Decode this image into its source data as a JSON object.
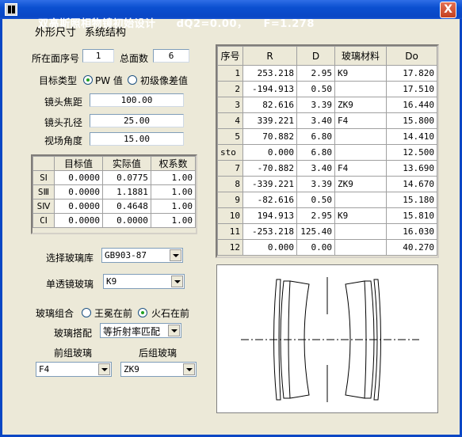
{
  "window": {
    "title": "双高斯照相物镜初始设计",
    "status_dq2": "dQ2=0.00，",
    "status_f": "F=1.278",
    "close_label": "X"
  },
  "menu": {
    "items": [
      "外形尺寸",
      "系统结构"
    ]
  },
  "surface": {
    "label": "所在面序号",
    "value": "1",
    "total_label": "总面数",
    "total_value": "6"
  },
  "target_type": {
    "label": "目标类型",
    "options": [
      "PW 值",
      "初级像差值"
    ],
    "selected": 0
  },
  "params": [
    {
      "label": "镜头焦距",
      "value": "100.00"
    },
    {
      "label": "镜头孔径",
      "value": "25.00"
    },
    {
      "label": "视场角度",
      "value": "15.00"
    }
  ],
  "aberration_table": {
    "headers": [
      "目标值",
      "实际值",
      "权系数"
    ],
    "rows": [
      {
        "name": "SⅠ",
        "target": "0.0000",
        "actual": "0.0775",
        "weight": "1.00"
      },
      {
        "name": "SⅢ",
        "target": "0.0000",
        "actual": "1.1881",
        "weight": "1.00"
      },
      {
        "name": "SⅣ",
        "target": "0.0000",
        "actual": "0.4648",
        "weight": "1.00"
      },
      {
        "name": "CⅠ",
        "target": "0.0000",
        "actual": "0.0000",
        "weight": "1.00"
      }
    ]
  },
  "glass_library": {
    "label": "选择玻璃库",
    "value": "GB903-87"
  },
  "single_lens_glass": {
    "label": "单透镜玻璃",
    "value": "K9"
  },
  "glass_combo": {
    "label": "玻璃组合",
    "options": [
      "王冕在前",
      "火石在前"
    ],
    "selected": 1
  },
  "glass_match": {
    "label": "玻璃搭配",
    "value": "等折射率匹配"
  },
  "front_group": {
    "label": "前组玻璃",
    "value": "F4"
  },
  "rear_group": {
    "label": "后组玻璃",
    "value": "ZK9"
  },
  "surface_table": {
    "headers": [
      "序号",
      "R",
      "D",
      "玻璃材料",
      "Do"
    ],
    "rows": [
      {
        "n": "1",
        "r": "253.218",
        "d": "2.95",
        "glass": "K9",
        "do": "17.820"
      },
      {
        "n": "2",
        "r": "-194.913",
        "d": "0.50",
        "glass": "",
        "do": "17.510"
      },
      {
        "n": "3",
        "r": "82.616",
        "d": "3.39",
        "glass": "ZK9",
        "do": "16.440"
      },
      {
        "n": "4",
        "r": "339.221",
        "d": "3.40",
        "glass": "F4",
        "do": "15.800"
      },
      {
        "n": "5",
        "r": "70.882",
        "d": "6.80",
        "glass": "",
        "do": "14.410"
      },
      {
        "n": "sto",
        "r": "0.000",
        "d": "6.80",
        "glass": "",
        "do": "12.500"
      },
      {
        "n": "7",
        "r": "-70.882",
        "d": "3.40",
        "glass": "F4",
        "do": "13.690"
      },
      {
        "n": "8",
        "r": "-339.221",
        "d": "3.39",
        "glass": "ZK9",
        "do": "14.670"
      },
      {
        "n": "9",
        "r": "-82.616",
        "d": "0.50",
        "glass": "",
        "do": "15.180"
      },
      {
        "n": "10",
        "r": "194.913",
        "d": "2.95",
        "glass": "K9",
        "do": "15.810"
      },
      {
        "n": "11",
        "r": "-253.218",
        "d": "125.40",
        "glass": "",
        "do": "16.030"
      },
      {
        "n": "12",
        "r": "0.000",
        "d": "0.00",
        "glass": "",
        "do": "40.270"
      }
    ]
  },
  "colors": {
    "title_bar": "#0a46c4",
    "close": "#c4401f",
    "face": "#ece9d8"
  }
}
